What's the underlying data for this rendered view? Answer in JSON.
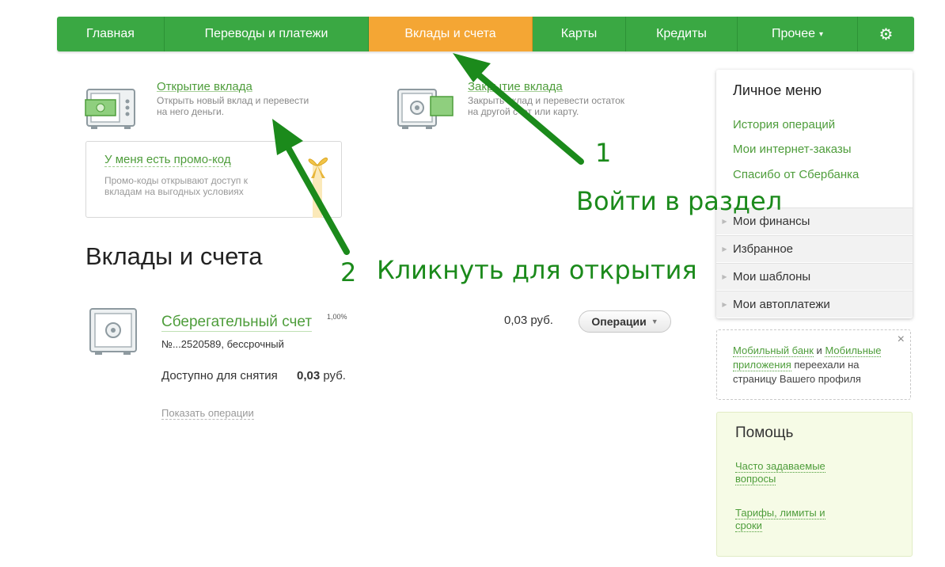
{
  "nav": {
    "items": [
      {
        "label": "Главная",
        "active": false
      },
      {
        "label": "Переводы и платежи",
        "active": false
      },
      {
        "label": "Вклады и счета",
        "active": true
      },
      {
        "label": "Карты",
        "active": false
      },
      {
        "label": "Кредиты",
        "active": false
      },
      {
        "label": "Прочее",
        "active": false
      }
    ],
    "settings_icon": "gear-icon"
  },
  "services": {
    "open_deposit": {
      "title": "Открытие вклада",
      "desc": "Открыть новый вклад и перевести на него деньги."
    },
    "close_deposit": {
      "title": "Закрытие вклада",
      "desc": "Закрыть вклад и перевести остаток на другой счет или карту."
    }
  },
  "promo": {
    "title": "У меня есть промо-код",
    "desc": "Промо-коды открывают доступ к вкладам на выгодных условиях"
  },
  "main": {
    "heading": "Вклады и счета"
  },
  "account": {
    "name": "Сберегательный счет",
    "rate": "1,00%",
    "number": "№...2520589, бессрочный",
    "balance": "0,03 руб.",
    "available_label": "Доступно для снятия",
    "available_value": "0,03",
    "available_currency": "руб.",
    "ops_button": "Операции",
    "show_ops": "Показать операции"
  },
  "sidebar": {
    "title": "Личное меню",
    "links": [
      "История операций",
      "Мои интернет-заказы",
      "Спасибо от Сбербанка"
    ],
    "sections": [
      "Мои финансы",
      "Избранное",
      "Мои шаблоны",
      "Мои автоплатежи"
    ]
  },
  "notice": {
    "link1": "Мобильный банк",
    "conj": "и",
    "link2": "Мобильные приложения",
    "rest": "переехали на страницу Вашего профиля",
    "close": "×"
  },
  "help": {
    "title": "Помощь",
    "links": [
      "Часто задаваемые вопросы",
      "Тарифы, лимиты и сроки"
    ]
  },
  "annotations": {
    "step1_num": "1",
    "step1_text": "Войти в раздел",
    "step2_num": "2",
    "step2_text": "Кликнуть для открытия"
  },
  "colors": {
    "brand_green": "#3aa843",
    "active_orange": "#f4a634",
    "annotation_green": "#1b8a1b"
  }
}
